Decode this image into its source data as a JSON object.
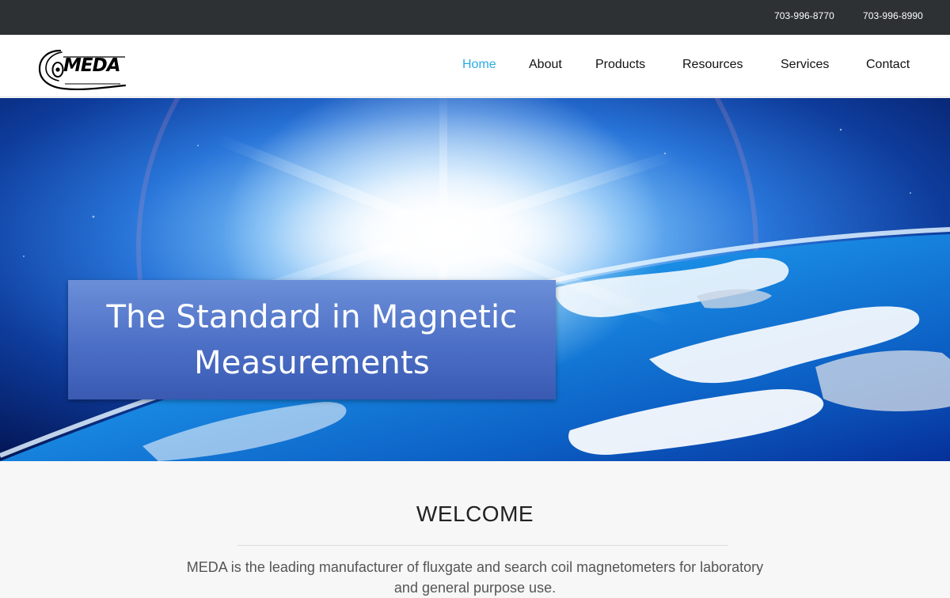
{
  "topbar": {
    "phones": [
      "703-996-8770",
      "703-996-8990"
    ]
  },
  "logo": {
    "text": "MEDA"
  },
  "nav": {
    "items": [
      {
        "label": "Home",
        "active": true
      },
      {
        "label": "About",
        "active": false
      },
      {
        "label": "Products",
        "active": false
      },
      {
        "label": "Resources",
        "active": false
      },
      {
        "label": "Services",
        "active": false
      },
      {
        "label": "Contact",
        "active": false
      }
    ]
  },
  "hero": {
    "headline_line1": "The Standard in Magnetic",
    "headline_line2": "Measurements"
  },
  "welcome": {
    "title": "WELCOME",
    "body": "MEDA is the leading manufacturer of fluxgate and search coil magnetometers for laboratory and general purpose use."
  },
  "colors": {
    "topbar_bg": "#2d3133",
    "nav_active": "#29abe2",
    "banner_blue": "#4c6fc6"
  }
}
